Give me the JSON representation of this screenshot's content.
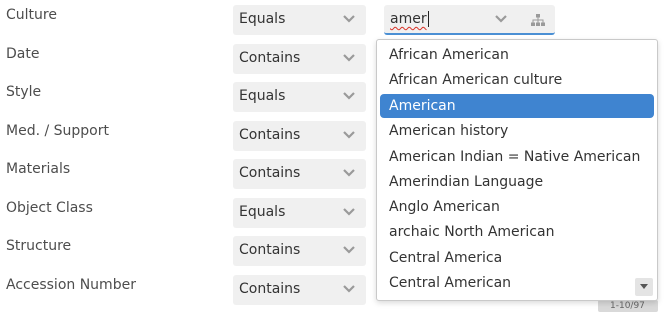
{
  "fields": [
    {
      "label": "Culture",
      "operator": "Equals"
    },
    {
      "label": "Date",
      "operator": "Contains"
    },
    {
      "label": "Style",
      "operator": "Equals"
    },
    {
      "label": "Med. / Support",
      "operator": "Contains"
    },
    {
      "label": "Materials",
      "operator": "Contains"
    },
    {
      "label": "Object Class",
      "operator": "Equals"
    },
    {
      "label": "Structure",
      "operator": "Contains"
    },
    {
      "label": "Accession Number",
      "operator": "Contains"
    }
  ],
  "culture_value": "amer",
  "dropdown": {
    "options": [
      "African American",
      "African American culture",
      "American",
      "American history",
      "American Indian = Native American",
      "Amerindian Language",
      "Anglo American",
      "archaic North American",
      "Central America",
      "Central American"
    ],
    "selected": "American"
  },
  "pager_text": "1-10/97",
  "colors": {
    "highlight": "#3f84d0",
    "input_underline": "#4a8fd4",
    "field_bg": "#f0f0f0"
  },
  "icons": {
    "operator_dropdown": "chevron-down-icon",
    "value_dropdown": "chevron-down-icon",
    "hierarchy": "tree-hierarchy-icon",
    "scroll_down": "triangle-down-icon"
  }
}
